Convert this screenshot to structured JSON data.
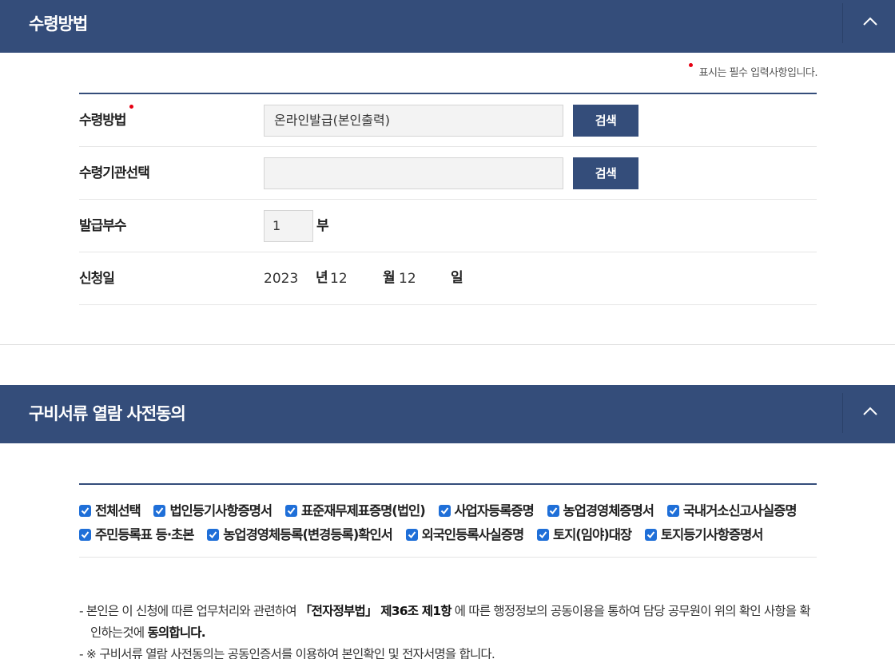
{
  "section1": {
    "title": "수령방법",
    "required_note": "표시는 필수 입력사항입니다."
  },
  "form": {
    "receive_method": {
      "label": "수령방법",
      "value": "온라인발급(본인출력)",
      "button": "검색"
    },
    "receive_institution": {
      "label": "수령기관선택",
      "value": "",
      "button": "검색"
    },
    "copies": {
      "label": "발급부수",
      "value": "1",
      "unit": "부"
    },
    "apply_date": {
      "label": "신청일",
      "year": "2023",
      "year_unit": "년",
      "month": "12",
      "month_unit": "월",
      "day": "12",
      "day_unit": "일"
    }
  },
  "section2": {
    "title": "구비서류 열람 사전동의",
    "checkboxes": [
      {
        "label": "전체선택",
        "checked": true
      },
      {
        "label": "법인등기사항증명서",
        "checked": true
      },
      {
        "label": "표준재무제표증명(법인)",
        "checked": true
      },
      {
        "label": "사업자등록증명",
        "checked": true
      },
      {
        "label": "농업경영체증명서",
        "checked": true
      },
      {
        "label": "국내거소신고사실증명",
        "checked": true
      },
      {
        "label": "주민등록표 등·초본",
        "checked": true
      },
      {
        "label": "농업경영체등록(변경등록)확인서",
        "checked": true
      },
      {
        "label": "외국인등록사실증명",
        "checked": true
      },
      {
        "label": "토지(임야)대장",
        "checked": true
      },
      {
        "label": "토지등기사항증명서",
        "checked": true
      }
    ],
    "notice1": {
      "prefix": "- 본인은 이 신청에 따른 업무처리와 관련하여 ",
      "law": "「전자정부법」 제36조 제1항",
      "middle": " 에 따른 행정정보의 공동이용을 통하여 담당 공무원이 위의 확인 사항을 확인하는것에 ",
      "agree": "동의합니다."
    },
    "notice2": "- ※ 구비서류 열람 사전동의는 공동인증서를 이용하여 본인확인 및 전자서명을 합니다."
  },
  "colors": {
    "header_bg": "#344d7a",
    "required_dot": "#e60012",
    "checkbox": "#1f6fd8"
  },
  "icons": {
    "collapse": "chevron-up-icon",
    "required": "red-dot-icon",
    "check": "check-icon"
  }
}
